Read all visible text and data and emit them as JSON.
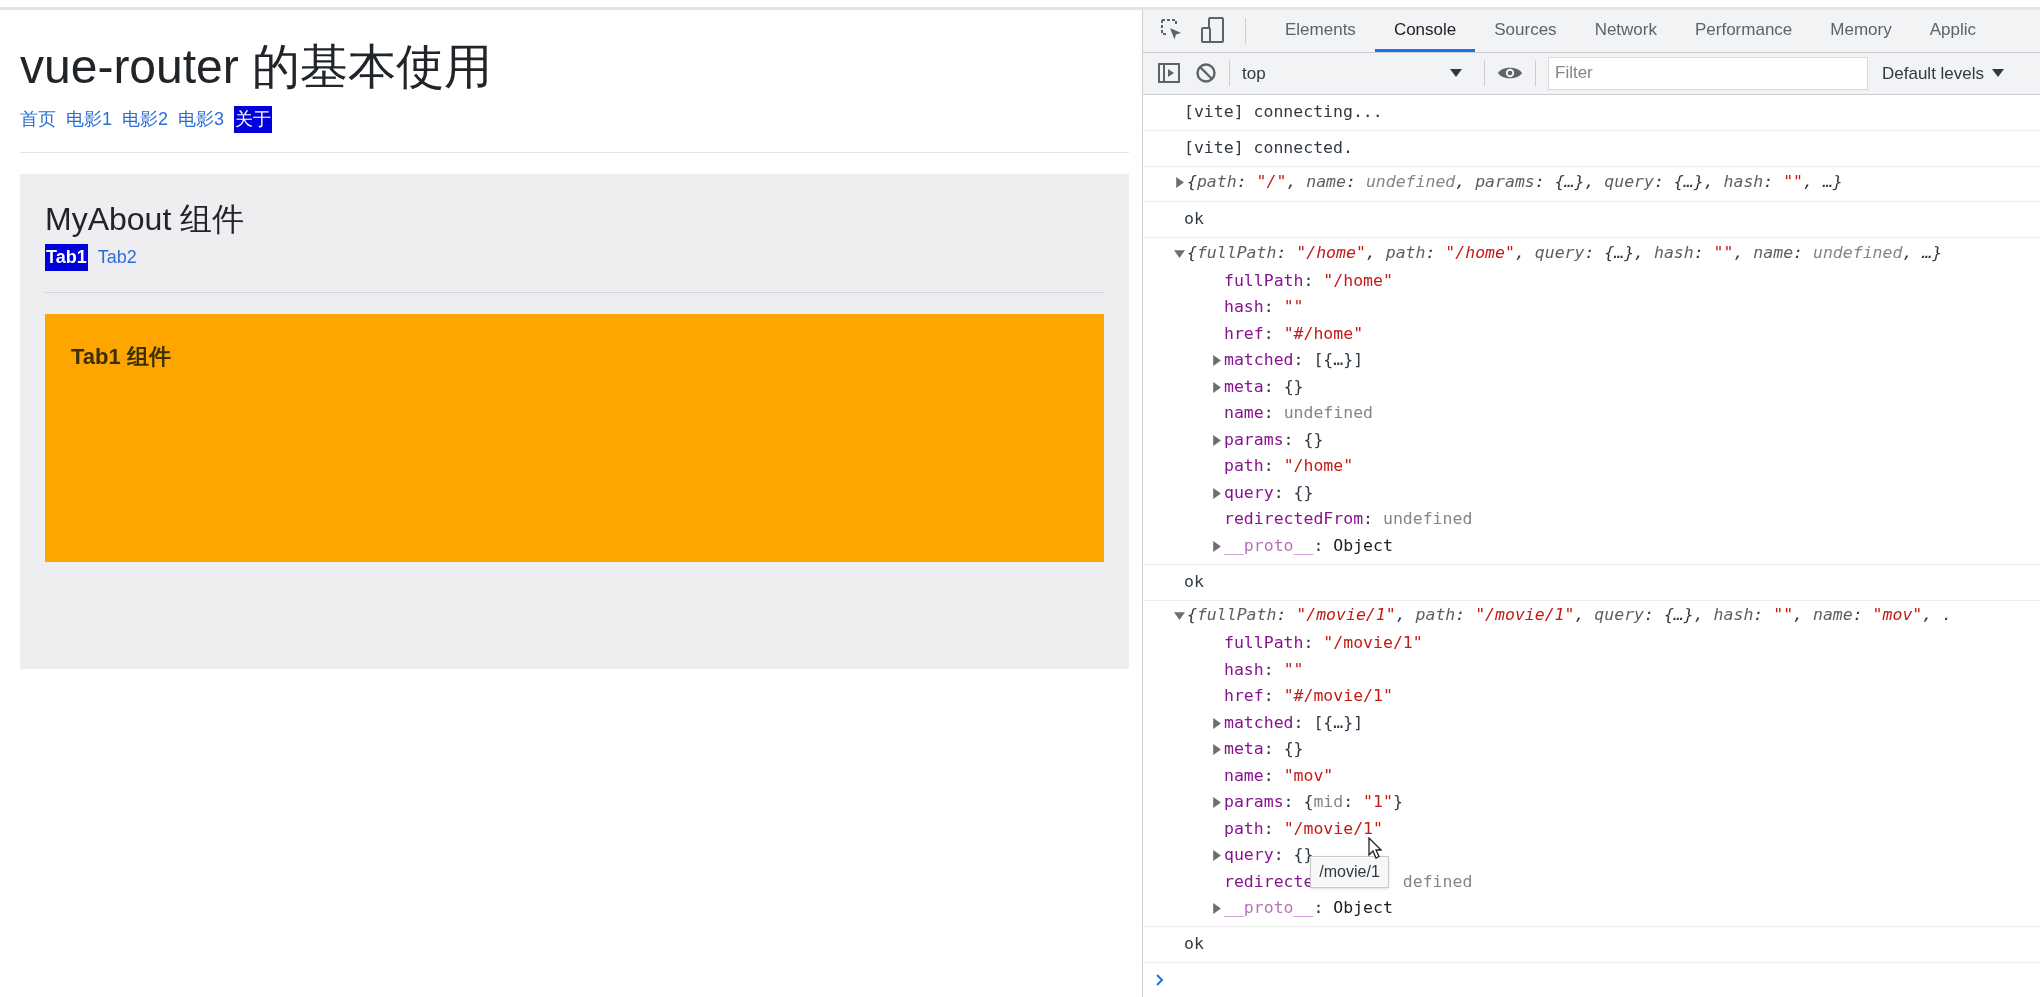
{
  "page": {
    "title": "vue-router 的基本使用",
    "nav": [
      {
        "label": "首页",
        "selected": false
      },
      {
        "label": "电影1",
        "selected": false
      },
      {
        "label": "电影2",
        "selected": false
      },
      {
        "label": "电影3",
        "selected": false
      },
      {
        "label": "关于",
        "selected": true
      }
    ],
    "about": {
      "title": "MyAbout 组件",
      "tabs": [
        {
          "label": "Tab1",
          "selected": true
        },
        {
          "label": "Tab2",
          "selected": false
        }
      ],
      "panel_text": "Tab1 组件"
    }
  },
  "devtools": {
    "tabs": [
      {
        "label": "Elements",
        "selected": false
      },
      {
        "label": "Console",
        "selected": true
      },
      {
        "label": "Sources",
        "selected": false
      },
      {
        "label": "Network",
        "selected": false
      },
      {
        "label": "Performance",
        "selected": false
      },
      {
        "label": "Memory",
        "selected": false
      },
      {
        "label": "Applic",
        "selected": false
      }
    ],
    "context": "top",
    "filter_placeholder": "Filter",
    "levels": "Default levels",
    "console": [
      {
        "kind": "log",
        "text": "[vite] connecting..."
      },
      {
        "kind": "log",
        "text": "[vite] connected."
      },
      {
        "kind": "object",
        "expanded": false,
        "summary": [
          {
            "kind": "punct",
            "text": "{"
          },
          {
            "kind": "key",
            "text": "path"
          },
          {
            "kind": "punct",
            "text": ": "
          },
          {
            "kind": "string",
            "text": "\"/\""
          },
          {
            "kind": "punct",
            "text": ", "
          },
          {
            "kind": "key",
            "text": "name"
          },
          {
            "kind": "punct",
            "text": ": "
          },
          {
            "kind": "dim",
            "text": "undefined"
          },
          {
            "kind": "punct",
            "text": ", "
          },
          {
            "kind": "key",
            "text": "params"
          },
          {
            "kind": "punct",
            "text": ": {…}, "
          },
          {
            "kind": "key",
            "text": "query"
          },
          {
            "kind": "punct",
            "text": ": {…}, "
          },
          {
            "kind": "key",
            "text": "hash"
          },
          {
            "kind": "punct",
            "text": ": "
          },
          {
            "kind": "string",
            "text": "\"\""
          },
          {
            "kind": "punct",
            "text": ", …}"
          }
        ]
      },
      {
        "kind": "log",
        "text": "ok"
      },
      {
        "kind": "object",
        "expanded": true,
        "summary": [
          {
            "kind": "punct",
            "text": "{"
          },
          {
            "kind": "key",
            "text": "fullPath"
          },
          {
            "kind": "punct",
            "text": ": "
          },
          {
            "kind": "string",
            "text": "\"/home\""
          },
          {
            "kind": "punct",
            "text": ", "
          },
          {
            "kind": "key",
            "text": "path"
          },
          {
            "kind": "punct",
            "text": ": "
          },
          {
            "kind": "string",
            "text": "\"/home\""
          },
          {
            "kind": "punct",
            "text": ", "
          },
          {
            "kind": "key",
            "text": "query"
          },
          {
            "kind": "punct",
            "text": ": {…}, "
          },
          {
            "kind": "key",
            "text": "hash"
          },
          {
            "kind": "punct",
            "text": ": "
          },
          {
            "kind": "string",
            "text": "\"\""
          },
          {
            "kind": "punct",
            "text": ", "
          },
          {
            "kind": "key",
            "text": "name"
          },
          {
            "kind": "punct",
            "text": ": "
          },
          {
            "kind": "dim",
            "text": "undefined"
          },
          {
            "kind": "punct",
            "text": ", …}"
          }
        ],
        "properties": [
          {
            "kind": "plain",
            "key": "fullPath",
            "sep": ": ",
            "value": [
              {
                "kind": "string",
                "text": "\"/home\""
              }
            ]
          },
          {
            "kind": "plain",
            "key": "hash",
            "sep": ": ",
            "value": [
              {
                "kind": "string",
                "text": "\"\""
              }
            ]
          },
          {
            "kind": "plain",
            "key": "href",
            "sep": ": ",
            "value": [
              {
                "kind": "string",
                "text": "\"#/home\""
              }
            ]
          },
          {
            "kind": "expandable",
            "key": "matched",
            "sep": ": ",
            "value": [
              {
                "kind": "punct",
                "text": "[{…}]"
              }
            ]
          },
          {
            "kind": "expandable",
            "key": "meta",
            "sep": ": ",
            "value": [
              {
                "kind": "punct",
                "text": "{}"
              }
            ]
          },
          {
            "kind": "plain",
            "key": "name",
            "sep": ": ",
            "value": [
              {
                "kind": "dim",
                "text": "undefined"
              }
            ]
          },
          {
            "kind": "expandable",
            "key": "params",
            "sep": ": ",
            "value": [
              {
                "kind": "punct",
                "text": "{}"
              }
            ]
          },
          {
            "kind": "plain",
            "key": "path",
            "sep": ": ",
            "value": [
              {
                "kind": "string",
                "text": "\"/home\""
              }
            ]
          },
          {
            "kind": "expandable",
            "key": "query",
            "sep": ": ",
            "value": [
              {
                "kind": "punct",
                "text": "{}"
              }
            ]
          },
          {
            "kind": "plain",
            "key": "redirectedFrom",
            "sep": ": ",
            "value": [
              {
                "kind": "dim",
                "text": "undefined"
              }
            ]
          },
          {
            "kind": "proto",
            "key": "__proto__",
            "sep": ": ",
            "value": [
              {
                "kind": "object",
                "text": "Object"
              }
            ]
          }
        ]
      },
      {
        "kind": "log",
        "text": "ok"
      },
      {
        "kind": "object",
        "expanded": true,
        "summary": [
          {
            "kind": "punct",
            "text": "{"
          },
          {
            "kind": "key",
            "text": "fullPath"
          },
          {
            "kind": "punct",
            "text": ": "
          },
          {
            "kind": "string",
            "text": "\"/movie/1\""
          },
          {
            "kind": "punct",
            "text": ", "
          },
          {
            "kind": "key",
            "text": "path"
          },
          {
            "kind": "punct",
            "text": ": "
          },
          {
            "kind": "string",
            "text": "\"/movie/1\""
          },
          {
            "kind": "punct",
            "text": ", "
          },
          {
            "kind": "key",
            "text": "query"
          },
          {
            "kind": "punct",
            "text": ": {…}, "
          },
          {
            "kind": "key",
            "text": "hash"
          },
          {
            "kind": "punct",
            "text": ": "
          },
          {
            "kind": "string",
            "text": "\"\""
          },
          {
            "kind": "punct",
            "text": ", "
          },
          {
            "kind": "key",
            "text": "name"
          },
          {
            "kind": "punct",
            "text": ": "
          },
          {
            "kind": "string",
            "text": "\"mov\""
          },
          {
            "kind": "punct",
            "text": ", ."
          }
        ],
        "properties": [
          {
            "kind": "plain",
            "key": "fullPath",
            "sep": ": ",
            "value": [
              {
                "kind": "string",
                "text": "\"/movie/1\""
              }
            ]
          },
          {
            "kind": "plain",
            "key": "hash",
            "sep": ": ",
            "value": [
              {
                "kind": "string",
                "text": "\"\""
              }
            ]
          },
          {
            "kind": "plain",
            "key": "href",
            "sep": ": ",
            "value": [
              {
                "kind": "string",
                "text": "\"#/movie/1\""
              }
            ]
          },
          {
            "kind": "expandable",
            "key": "matched",
            "sep": ": ",
            "value": [
              {
                "kind": "punct",
                "text": "[{…}]"
              }
            ]
          },
          {
            "kind": "expandable",
            "key": "meta",
            "sep": ": ",
            "value": [
              {
                "kind": "punct",
                "text": "{}"
              }
            ]
          },
          {
            "kind": "plain",
            "key": "name",
            "sep": ": ",
            "value": [
              {
                "kind": "string",
                "text": "\"mov\""
              }
            ]
          },
          {
            "kind": "expandable",
            "key": "params",
            "sep": ": ",
            "value": [
              {
                "kind": "punct",
                "text": "{"
              },
              {
                "kind": "dim",
                "text": "mid"
              },
              {
                "kind": "punct",
                "text": ": "
              },
              {
                "kind": "string",
                "text": "\"1\""
              },
              {
                "kind": "punct",
                "text": "}"
              }
            ]
          },
          {
            "kind": "plain",
            "key": "path",
            "sep": ": ",
            "value": [
              {
                "kind": "string",
                "text": "\"/movie/1\""
              }
            ]
          },
          {
            "kind": "expandable",
            "key": "query",
            "sep": ": ",
            "value": [
              {
                "kind": "punct",
                "text": "{}"
              }
            ],
            "tooltip": "/movie/1"
          },
          {
            "kind": "covered",
            "key": "redirecte",
            "value": [
              {
                "kind": "dim",
                "text": "defined"
              }
            ]
          },
          {
            "kind": "proto",
            "key": "__proto__",
            "sep": ": ",
            "value": [
              {
                "kind": "object",
                "text": "Object"
              }
            ]
          }
        ]
      },
      {
        "kind": "log",
        "text": "ok"
      }
    ]
  }
}
